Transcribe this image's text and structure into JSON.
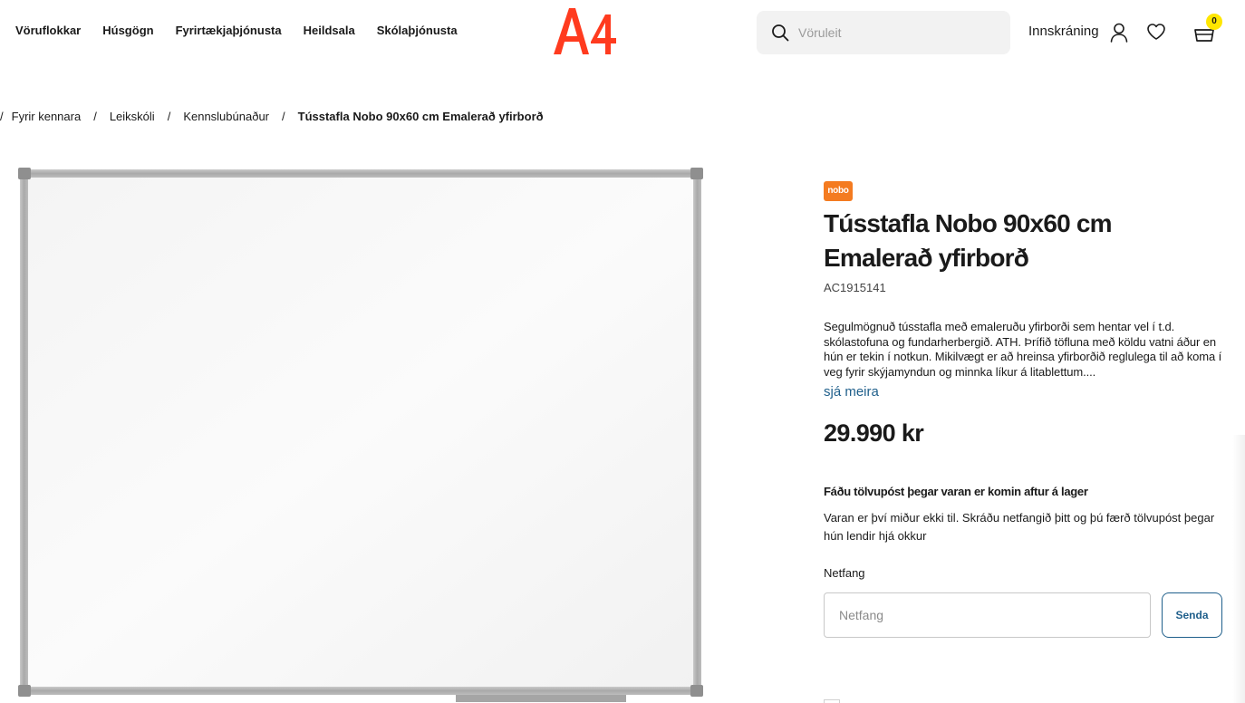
{
  "header": {
    "nav": [
      {
        "label": "Vöruflokkar"
      },
      {
        "label": "Húsgögn"
      },
      {
        "label": "Fyrirtækjaþjónusta"
      },
      {
        "label": "Heildsala"
      },
      {
        "label": "Skólaþjónusta"
      }
    ],
    "logo_text": "A4",
    "search_placeholder": "Vöruleit",
    "login_label": "Innskráning",
    "cart_count": "0",
    "colors": {
      "brand": "#ff3b1f",
      "badge": "#ffe600",
      "link": "#1f5f8b"
    }
  },
  "breadcrumb": [
    {
      "label": "Fyrir kennara"
    },
    {
      "label": "Leikskóli"
    },
    {
      "label": "Kennslubúnaður"
    },
    {
      "label": "Tússtafla Nobo 90x60 cm Emalerað yfirborð"
    }
  ],
  "product": {
    "brand_logo_text": "nobo",
    "title": "Tússtafla Nobo 90x60 cm Emalerað yfirborð",
    "sku": "AC1915141",
    "description": "Segulmögnuð tússtafla með emaleruðu yfirborði sem hentar vel í t.d. skólastofuna og fundarherbergið. ATH. Þrífið töfluna með köldu vatni áður en hún er tekin í notkun. Mikilvægt er að hreinsa yfirborðið reglulega til að koma í veg fyrir skýjamyndun og minnka líkur á litablettum....",
    "see_more": "sjá meira",
    "price": "29.990 kr"
  },
  "notify": {
    "title": "Fáðu tölvupóst þegar varan er komin aftur á lager",
    "text": "Varan er því miður ekki til. Skráðu netfangið þitt og þú færð tölvupóst þegar hún lendir hjá okkur",
    "email_label": "Netfang",
    "email_placeholder": "Netfang",
    "send_label": "Senda"
  }
}
